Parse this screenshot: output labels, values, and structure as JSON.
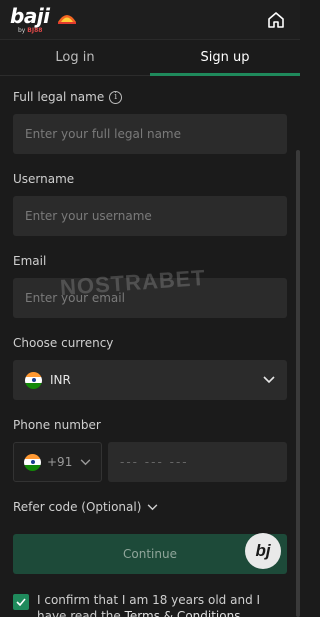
{
  "header": {
    "brand": "baji",
    "brand_sub_prefix": "by",
    "brand_sub_highlight": "BJ88",
    "partner_icon": "sunrisers-logo-icon",
    "home_icon": "home-icon"
  },
  "tabs": [
    {
      "label": "Log in",
      "active": false
    },
    {
      "label": "Sign up",
      "active": true
    }
  ],
  "form": {
    "full_name": {
      "label": "Full legal name",
      "placeholder": "Enter your full legal name",
      "info_icon": "i"
    },
    "username": {
      "label": "Username",
      "placeholder": "Enter your username"
    },
    "email": {
      "label": "Email",
      "placeholder": "Enter your email"
    },
    "currency": {
      "label": "Choose currency",
      "value": "INR"
    },
    "phone": {
      "label": "Phone number",
      "code": "+91",
      "placeholder": "--- --- ---"
    },
    "refer": {
      "label": "Refer code (Optional)"
    },
    "continue_label": "Continue",
    "confirm": {
      "text": "I confirm that I am 18 years old and I have read the ",
      "link": "Terms & Conditions",
      "checked": true
    }
  },
  "watermark": "NOSTRABET",
  "fab_label": "bj",
  "colors": {
    "accent": "#1f8a5c",
    "background": "#1b1b1b",
    "field": "#2b2b2b",
    "button": "#1d4a39"
  }
}
